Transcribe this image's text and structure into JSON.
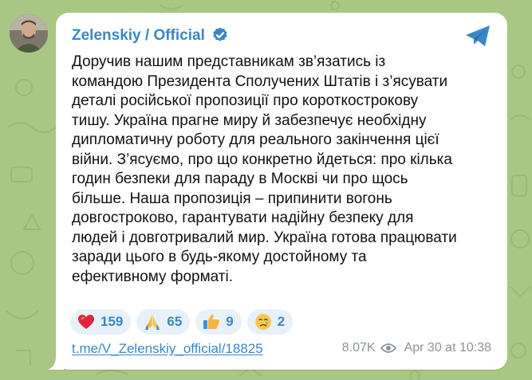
{
  "post": {
    "channel_name": "Zelenskiy / Official",
    "text": "Доручив нашим представникам зв’язатись із\nкомандою Президента Сполучених Штатів і з’ясувати\nдеталі російської пропозиції про короткострокову\nтишу. Україна прагне миру й забезпечує необхідну\nдипломатичну роботу для реального закінчення цієї\nвійни. З’ясуємо, про що конкретно йдеться: про кілька\nгодин безпеки для параду в Москві чи про щось\nбільше. Наша пропозиція – припинити вогонь\nдовгостроково, гарантувати надійну безпеку для\nлюдей і довготривалий мир. Україна готова працювати\nзаради цього в будь-якому достойному та\nефективному форматі.",
    "reactions": [
      {
        "icon": "red-heart",
        "count": "159"
      },
      {
        "icon": "folded-hands",
        "count": "65"
      },
      {
        "icon": "thumbs-up",
        "count": "9"
      },
      {
        "icon": "crying-face",
        "count": "2"
      }
    ],
    "link": "t.me/V_Zelenskiy_official/18825",
    "views": "8.07K",
    "date": "Apr 30 at 10:38"
  },
  "colors": {
    "accent": "#3a87c7",
    "background": "#a9c784",
    "bubble": "#ffffff",
    "reaction_bg": "#e8f1fa",
    "meta_text": "#8a939b"
  },
  "icons": {
    "verified": "verified-badge-icon",
    "share": "telegram-share-icon",
    "views": "eye-icon"
  }
}
